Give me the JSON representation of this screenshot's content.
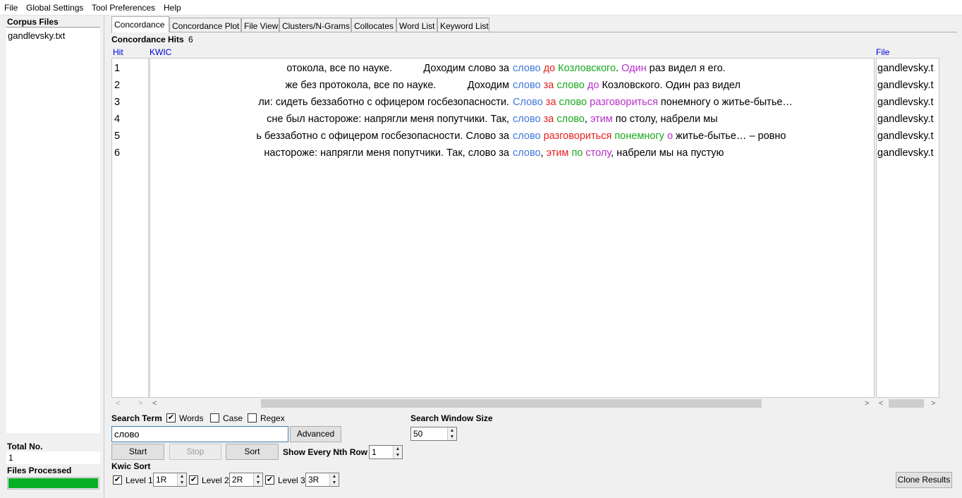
{
  "menu": [
    "File",
    "Global Settings",
    "Tool Preferences",
    "Help"
  ],
  "left_panel": {
    "corpus_files_label": "Corpus Files",
    "files": [
      "gandlevsky.txt"
    ],
    "total_no_label": "Total No.",
    "total_no_value": "1",
    "files_processed_label": "Files Processed",
    "progress_fraction": 1.0
  },
  "tabs": [
    "Concordance",
    "Concordance Plot",
    "File View",
    "Clusters/N-Grams",
    "Collocates",
    "Word List",
    "Keyword List"
  ],
  "active_tab": 0,
  "hits": {
    "label": "Concordance Hits",
    "count": "6"
  },
  "columns": {
    "hit": "Hit",
    "kwic": "KWIC",
    "file": "File"
  },
  "rows": [
    {
      "hit": "1",
      "left": "отокола, все по науке.           Доходим слово за",
      "right": [
        [
          "слово",
          "blue"
        ],
        [
          " ",
          ""
        ],
        [
          "до",
          "red"
        ],
        [
          " ",
          ""
        ],
        [
          "Козловского",
          "green"
        ],
        [
          ". ",
          ""
        ],
        [
          "Один",
          "purple"
        ],
        [
          " раз видел я его.",
          ""
        ]
      ],
      "file": "gandlevsky.t"
    },
    {
      "hit": "2",
      "left": "же без протокола, все по науке.           Доходим",
      "right": [
        [
          "слово",
          "blue"
        ],
        [
          " ",
          ""
        ],
        [
          "за",
          "red"
        ],
        [
          " ",
          ""
        ],
        [
          "слово",
          "green"
        ],
        [
          " ",
          ""
        ],
        [
          "до",
          "purple"
        ],
        [
          " Козловского. Один раз видел",
          ""
        ]
      ],
      "file": "gandlevsky.t"
    },
    {
      "hit": "3",
      "left": "ли: сидеть беззаботно с офицером госбезопасности.",
      "right": [
        [
          "Слово",
          "blue"
        ],
        [
          " ",
          ""
        ],
        [
          "за",
          "red"
        ],
        [
          " ",
          ""
        ],
        [
          "слово",
          "green"
        ],
        [
          " ",
          ""
        ],
        [
          "разговориться",
          "purple"
        ],
        [
          " понемногу о житье-бытье…",
          ""
        ]
      ],
      "file": "gandlevsky.t"
    },
    {
      "hit": "4",
      "left": "сне был настороже: напрягли меня попутчики. Так,",
      "right": [
        [
          "слово",
          "blue"
        ],
        [
          " ",
          ""
        ],
        [
          "за",
          "red"
        ],
        [
          " ",
          ""
        ],
        [
          "слово",
          "green"
        ],
        [
          ", ",
          ""
        ],
        [
          "этим",
          "purple"
        ],
        [
          " по столу, набрели мы",
          ""
        ]
      ],
      "file": "gandlevsky.t"
    },
    {
      "hit": "5",
      "left": "ь беззаботно с офицером госбезопасности. Слово за",
      "right": [
        [
          "слово",
          "blue"
        ],
        [
          " ",
          ""
        ],
        [
          "разговориться",
          "red"
        ],
        [
          " ",
          ""
        ],
        [
          "понемногу",
          "green"
        ],
        [
          " ",
          ""
        ],
        [
          "о",
          "purple"
        ],
        [
          " житье-бытье… – ровно",
          ""
        ]
      ],
      "file": "gandlevsky.t"
    },
    {
      "hit": "6",
      "left": "настороже: напрягли меня попутчики. Так, слово за",
      "right": [
        [
          "слово",
          "blue"
        ],
        [
          ", ",
          ""
        ],
        [
          "этим",
          "red"
        ],
        [
          " ",
          ""
        ],
        [
          "по",
          "green"
        ],
        [
          " ",
          ""
        ],
        [
          "столу",
          "purple"
        ],
        [
          ", набрели мы на пустую",
          ""
        ]
      ],
      "file": "gandlevsky.t"
    }
  ],
  "search": {
    "term_label": "Search Term",
    "words_label": "Words",
    "words_checked": true,
    "case_label": "Case",
    "case_checked": false,
    "regex_label": "Regex",
    "regex_checked": false,
    "value": "слово",
    "advanced_label": "Advanced",
    "window_size_label": "Search Window Size",
    "window_size_value": "50"
  },
  "buttons": {
    "start": "Start",
    "stop": "Stop",
    "sort": "Sort",
    "clone": "Clone Results"
  },
  "nth_row": {
    "label": "Show Every Nth Row",
    "value": "1"
  },
  "kwic_sort": {
    "label": "Kwic Sort",
    "levels": [
      {
        "label": "Level 1",
        "value": "1R",
        "checked": true
      },
      {
        "label": "Level 2",
        "value": "2R",
        "checked": true
      },
      {
        "label": "Level 3",
        "value": "3R",
        "checked": true
      }
    ]
  },
  "colors": {
    "blue": "#3f78d8",
    "red": "#e51f1f",
    "green": "#18a81e",
    "purple": "#b72fc7",
    "progress": "#06b025",
    "header": "#0000dd"
  }
}
